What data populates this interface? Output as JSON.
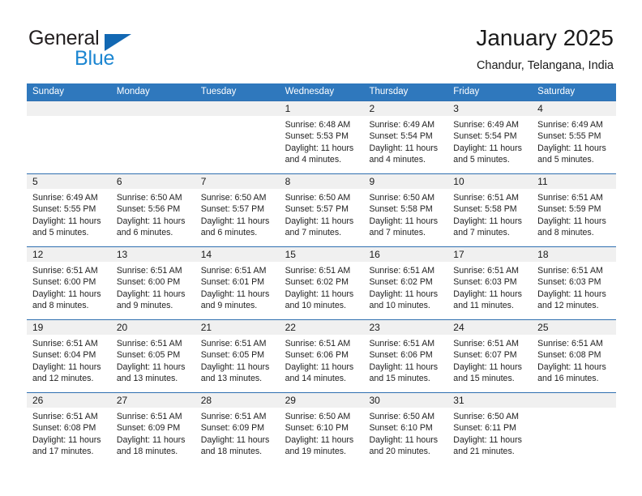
{
  "brand": {
    "name_part1": "General",
    "name_part2": "Blue",
    "triangle_color": "#1268b3",
    "blue_color": "#1c86d1"
  },
  "header": {
    "title": "January 2025",
    "location": "Chandur, Telangana, India"
  },
  "theme": {
    "header_row_bg": "#2f78bd",
    "row_border": "#2f6fb0",
    "day_number_strip_bg": "#f0f0f0",
    "text": "#1a1a1a"
  },
  "weekdays": [
    "Sunday",
    "Monday",
    "Tuesday",
    "Wednesday",
    "Thursday",
    "Friday",
    "Saturday"
  ],
  "weeks": [
    [
      {
        "day": "",
        "empty": true
      },
      {
        "day": "",
        "empty": true
      },
      {
        "day": "",
        "empty": true
      },
      {
        "day": "1",
        "sunrise": "Sunrise: 6:48 AM",
        "sunset": "Sunset: 5:53 PM",
        "daylight_1": "Daylight: 11 hours",
        "daylight_2": "and 4 minutes."
      },
      {
        "day": "2",
        "sunrise": "Sunrise: 6:49 AM",
        "sunset": "Sunset: 5:54 PM",
        "daylight_1": "Daylight: 11 hours",
        "daylight_2": "and 4 minutes."
      },
      {
        "day": "3",
        "sunrise": "Sunrise: 6:49 AM",
        "sunset": "Sunset: 5:54 PM",
        "daylight_1": "Daylight: 11 hours",
        "daylight_2": "and 5 minutes."
      },
      {
        "day": "4",
        "sunrise": "Sunrise: 6:49 AM",
        "sunset": "Sunset: 5:55 PM",
        "daylight_1": "Daylight: 11 hours",
        "daylight_2": "and 5 minutes."
      }
    ],
    [
      {
        "day": "5",
        "sunrise": "Sunrise: 6:49 AM",
        "sunset": "Sunset: 5:55 PM",
        "daylight_1": "Daylight: 11 hours",
        "daylight_2": "and 5 minutes."
      },
      {
        "day": "6",
        "sunrise": "Sunrise: 6:50 AM",
        "sunset": "Sunset: 5:56 PM",
        "daylight_1": "Daylight: 11 hours",
        "daylight_2": "and 6 minutes."
      },
      {
        "day": "7",
        "sunrise": "Sunrise: 6:50 AM",
        "sunset": "Sunset: 5:57 PM",
        "daylight_1": "Daylight: 11 hours",
        "daylight_2": "and 6 minutes."
      },
      {
        "day": "8",
        "sunrise": "Sunrise: 6:50 AM",
        "sunset": "Sunset: 5:57 PM",
        "daylight_1": "Daylight: 11 hours",
        "daylight_2": "and 7 minutes."
      },
      {
        "day": "9",
        "sunrise": "Sunrise: 6:50 AM",
        "sunset": "Sunset: 5:58 PM",
        "daylight_1": "Daylight: 11 hours",
        "daylight_2": "and 7 minutes."
      },
      {
        "day": "10",
        "sunrise": "Sunrise: 6:51 AM",
        "sunset": "Sunset: 5:58 PM",
        "daylight_1": "Daylight: 11 hours",
        "daylight_2": "and 7 minutes."
      },
      {
        "day": "11",
        "sunrise": "Sunrise: 6:51 AM",
        "sunset": "Sunset: 5:59 PM",
        "daylight_1": "Daylight: 11 hours",
        "daylight_2": "and 8 minutes."
      }
    ],
    [
      {
        "day": "12",
        "sunrise": "Sunrise: 6:51 AM",
        "sunset": "Sunset: 6:00 PM",
        "daylight_1": "Daylight: 11 hours",
        "daylight_2": "and 8 minutes."
      },
      {
        "day": "13",
        "sunrise": "Sunrise: 6:51 AM",
        "sunset": "Sunset: 6:00 PM",
        "daylight_1": "Daylight: 11 hours",
        "daylight_2": "and 9 minutes."
      },
      {
        "day": "14",
        "sunrise": "Sunrise: 6:51 AM",
        "sunset": "Sunset: 6:01 PM",
        "daylight_1": "Daylight: 11 hours",
        "daylight_2": "and 9 minutes."
      },
      {
        "day": "15",
        "sunrise": "Sunrise: 6:51 AM",
        "sunset": "Sunset: 6:02 PM",
        "daylight_1": "Daylight: 11 hours",
        "daylight_2": "and 10 minutes."
      },
      {
        "day": "16",
        "sunrise": "Sunrise: 6:51 AM",
        "sunset": "Sunset: 6:02 PM",
        "daylight_1": "Daylight: 11 hours",
        "daylight_2": "and 10 minutes."
      },
      {
        "day": "17",
        "sunrise": "Sunrise: 6:51 AM",
        "sunset": "Sunset: 6:03 PM",
        "daylight_1": "Daylight: 11 hours",
        "daylight_2": "and 11 minutes."
      },
      {
        "day": "18",
        "sunrise": "Sunrise: 6:51 AM",
        "sunset": "Sunset: 6:03 PM",
        "daylight_1": "Daylight: 11 hours",
        "daylight_2": "and 12 minutes."
      }
    ],
    [
      {
        "day": "19",
        "sunrise": "Sunrise: 6:51 AM",
        "sunset": "Sunset: 6:04 PM",
        "daylight_1": "Daylight: 11 hours",
        "daylight_2": "and 12 minutes."
      },
      {
        "day": "20",
        "sunrise": "Sunrise: 6:51 AM",
        "sunset": "Sunset: 6:05 PM",
        "daylight_1": "Daylight: 11 hours",
        "daylight_2": "and 13 minutes."
      },
      {
        "day": "21",
        "sunrise": "Sunrise: 6:51 AM",
        "sunset": "Sunset: 6:05 PM",
        "daylight_1": "Daylight: 11 hours",
        "daylight_2": "and 13 minutes."
      },
      {
        "day": "22",
        "sunrise": "Sunrise: 6:51 AM",
        "sunset": "Sunset: 6:06 PM",
        "daylight_1": "Daylight: 11 hours",
        "daylight_2": "and 14 minutes."
      },
      {
        "day": "23",
        "sunrise": "Sunrise: 6:51 AM",
        "sunset": "Sunset: 6:06 PM",
        "daylight_1": "Daylight: 11 hours",
        "daylight_2": "and 15 minutes."
      },
      {
        "day": "24",
        "sunrise": "Sunrise: 6:51 AM",
        "sunset": "Sunset: 6:07 PM",
        "daylight_1": "Daylight: 11 hours",
        "daylight_2": "and 15 minutes."
      },
      {
        "day": "25",
        "sunrise": "Sunrise: 6:51 AM",
        "sunset": "Sunset: 6:08 PM",
        "daylight_1": "Daylight: 11 hours",
        "daylight_2": "and 16 minutes."
      }
    ],
    [
      {
        "day": "26",
        "sunrise": "Sunrise: 6:51 AM",
        "sunset": "Sunset: 6:08 PM",
        "daylight_1": "Daylight: 11 hours",
        "daylight_2": "and 17 minutes."
      },
      {
        "day": "27",
        "sunrise": "Sunrise: 6:51 AM",
        "sunset": "Sunset: 6:09 PM",
        "daylight_1": "Daylight: 11 hours",
        "daylight_2": "and 18 minutes."
      },
      {
        "day": "28",
        "sunrise": "Sunrise: 6:51 AM",
        "sunset": "Sunset: 6:09 PM",
        "daylight_1": "Daylight: 11 hours",
        "daylight_2": "and 18 minutes."
      },
      {
        "day": "29",
        "sunrise": "Sunrise: 6:50 AM",
        "sunset": "Sunset: 6:10 PM",
        "daylight_1": "Daylight: 11 hours",
        "daylight_2": "and 19 minutes."
      },
      {
        "day": "30",
        "sunrise": "Sunrise: 6:50 AM",
        "sunset": "Sunset: 6:10 PM",
        "daylight_1": "Daylight: 11 hours",
        "daylight_2": "and 20 minutes."
      },
      {
        "day": "31",
        "sunrise": "Sunrise: 6:50 AM",
        "sunset": "Sunset: 6:11 PM",
        "daylight_1": "Daylight: 11 hours",
        "daylight_2": "and 21 minutes."
      },
      {
        "day": "",
        "empty": true
      }
    ]
  ]
}
